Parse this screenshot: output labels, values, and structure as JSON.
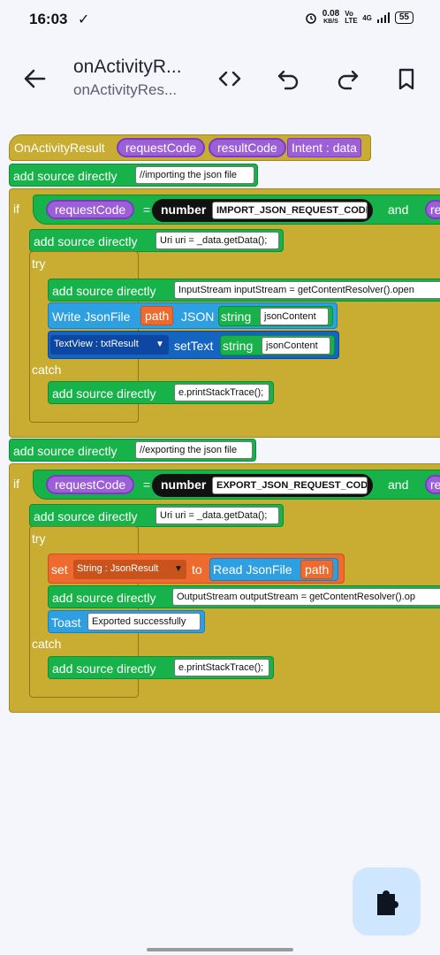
{
  "status": {
    "time": "16:03",
    "check": "✓",
    "speed": "0.08",
    "speed_unit": "KB/S",
    "network": "4G",
    "volte": "Vo LTE",
    "battery": "55"
  },
  "toolbar": {
    "title": "onActivityR...",
    "subtitle": "onActivityRes..."
  },
  "blocks": {
    "event": {
      "name": "OnActivityResult",
      "p1": "requestCode",
      "p2": "resultCode",
      "p3": "Intent : data"
    },
    "src1": {
      "label": "add source directly",
      "value": "//importing the json file"
    },
    "if1": {
      "kw": "if",
      "var": "requestCode",
      "eq": "=",
      "num": "number",
      "const": "IMPORT_JSON_REQUEST_CODE",
      "and": "and",
      "tail": "re"
    },
    "src2": {
      "label": "add source directly",
      "value": "Uri uri = _data.getData();"
    },
    "try1": "try",
    "src3": {
      "label": "add source directly",
      "value": "InputStream inputStream = getContentResolver().open"
    },
    "write": {
      "label": "Write JsonFile",
      "path": "path",
      "json": "JSON",
      "string": "string",
      "value": "jsonContent"
    },
    "settext": {
      "view": "TextView : txtResult",
      "label": "setText",
      "string": "string",
      "value": "jsonContent"
    },
    "catch1": "catch",
    "src4": {
      "label": "add source directly",
      "value": "e.printStackTrace();"
    },
    "src5": {
      "label": "add source directly",
      "value": "//exporting the json file"
    },
    "if2": {
      "kw": "if",
      "var": "requestCode",
      "eq": "=",
      "num": "number",
      "const": "EXPORT_JSON_REQUEST_CODE",
      "and": "and",
      "tail": "re"
    },
    "src6": {
      "label": "add source directly",
      "value": "Uri uri = _data.getData();"
    },
    "try2": "try",
    "setvar": {
      "set": "set",
      "var": "String : JsonResult",
      "to": "to",
      "read": "Read JsonFile",
      "path": "path"
    },
    "src7": {
      "label": "add source directly",
      "value": "OutputStream outputStream = getContentResolver().op"
    },
    "toast": {
      "label": "Toast",
      "value": "Exported successfully"
    },
    "catch2": "catch",
    "src8": {
      "label": "add source directly",
      "value": "e.printStackTrace();"
    }
  },
  "icons": [
    "back-arrow-icon",
    "code-icon",
    "undo-icon",
    "redo-icon",
    "bookmark-icon",
    "puzzle-icon"
  ],
  "colors": {
    "control": "#c9ac32",
    "source": "#18b24a",
    "event_param": "#9c5fd8",
    "view": "#1565c0",
    "variable": "#ee6a2e",
    "file": "#2ea0e2"
  }
}
